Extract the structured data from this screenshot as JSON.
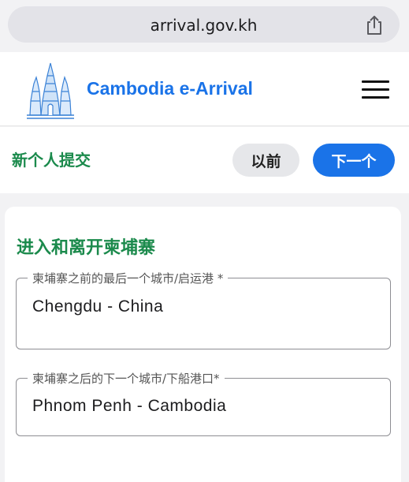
{
  "browser": {
    "url": "arrival.gov.kh"
  },
  "header": {
    "brand": "Cambodia e-Arrival"
  },
  "subbar": {
    "title": "新个人提交",
    "prev_label": "以前",
    "next_label": "下一个"
  },
  "section": {
    "title": "进入和离开柬埔寨",
    "fields": [
      {
        "label": "柬埔寨之前的最后一个城市/启运港 *",
        "value": "Chengdu - China"
      },
      {
        "label": "柬埔寨之后的下一个城市/下船港口*",
        "value": "Phnom Penh - Cambodia"
      }
    ]
  },
  "colors": {
    "brand_blue": "#1a73e8",
    "section_green": "#1b8a4c"
  },
  "icons": {
    "share": "share-icon",
    "menu": "hamburger-menu-icon",
    "logo": "angkor-temple-logo"
  }
}
